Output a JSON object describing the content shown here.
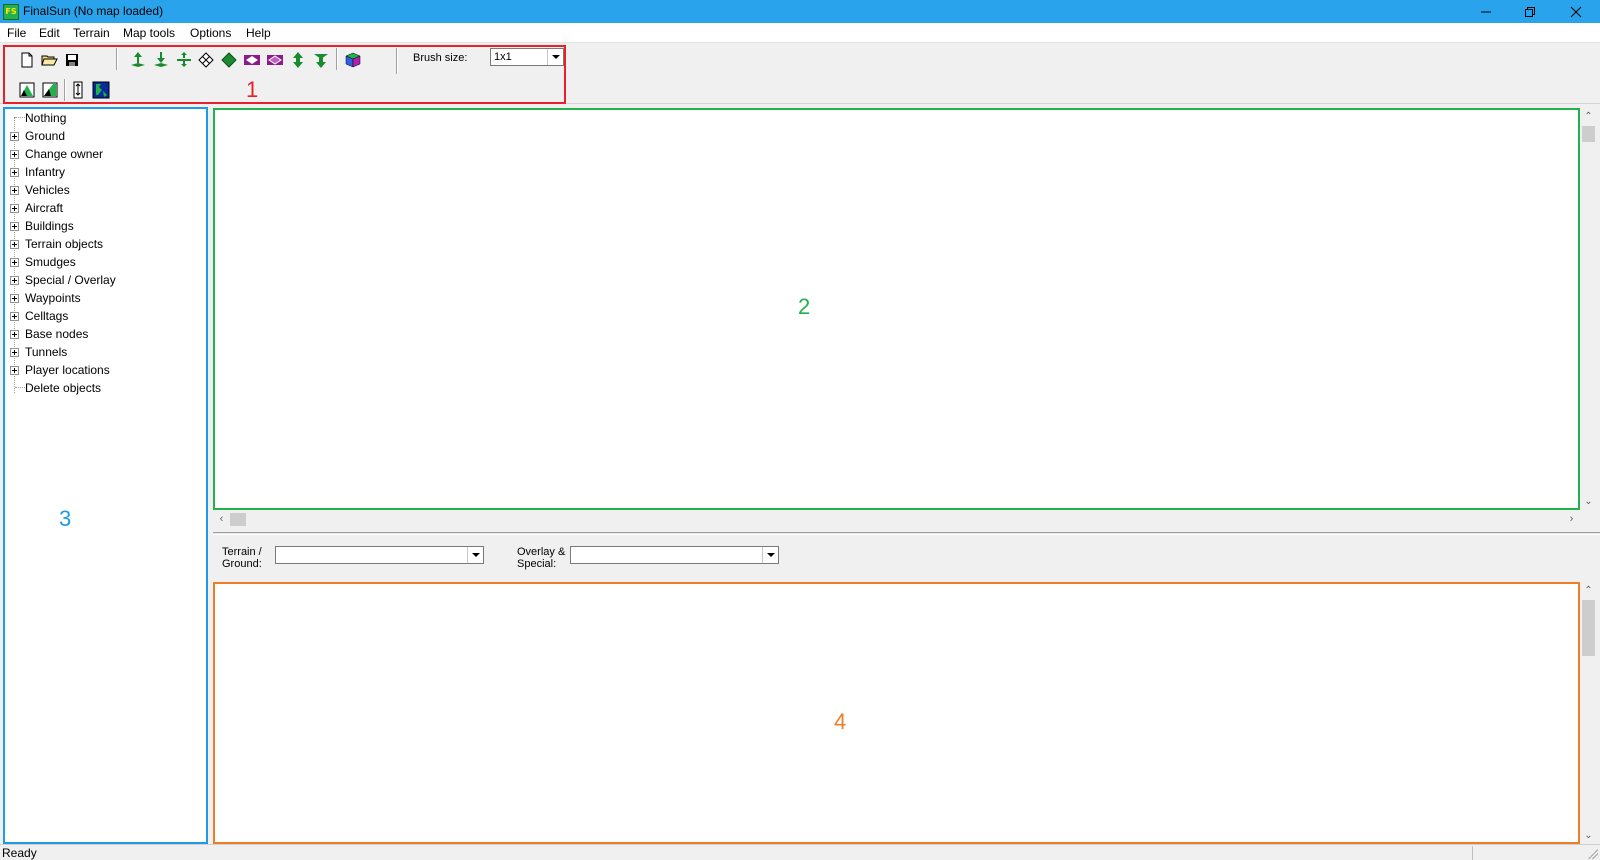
{
  "window": {
    "title": "FinalSun (No map loaded)",
    "icon_text": "FS",
    "controls": [
      "minimize-icon",
      "restore-icon",
      "close-icon"
    ]
  },
  "menu": [
    "File",
    "Edit",
    "Terrain",
    "Map tools",
    "Options",
    "Help"
  ],
  "toolbar": {
    "brush_label": "Brush size:",
    "brush_value": "1x1",
    "row1_icons": [
      "new-file-icon",
      "open-folder-icon",
      "save-icon",
      "raise-ground-icon",
      "lower-ground-icon",
      "flatten-ground-icon",
      "hide-tile-icon",
      "show-tile-icon",
      "raise-tile-purple-icon",
      "lower-tile-purple-icon",
      "raise-single-icon",
      "lower-single-icon",
      "cube-icon"
    ],
    "row2_icons": [
      "terrain-a-icon",
      "terrain-b-icon",
      "tube-icon",
      "waypoint-map-icon"
    ]
  },
  "annotations": {
    "one": "1",
    "two": "2",
    "three": "3",
    "four": "4",
    "colors": {
      "one": "#e8202a",
      "two": "#22b14c",
      "three": "#1e9be6",
      "four": "#ee7d27"
    }
  },
  "tree": {
    "items": [
      {
        "label": "Nothing",
        "expandable": false
      },
      {
        "label": "Ground",
        "expandable": true
      },
      {
        "label": "Change owner",
        "expandable": true
      },
      {
        "label": "Infantry",
        "expandable": true
      },
      {
        "label": "Vehicles",
        "expandable": true
      },
      {
        "label": "Aircraft",
        "expandable": true
      },
      {
        "label": "Buildings",
        "expandable": true
      },
      {
        "label": "Terrain objects",
        "expandable": true
      },
      {
        "label": "Smudges",
        "expandable": true
      },
      {
        "label": "Special / Overlay",
        "expandable": true
      },
      {
        "label": "Waypoints",
        "expandable": true
      },
      {
        "label": "Celltags",
        "expandable": true
      },
      {
        "label": "Base nodes",
        "expandable": true
      },
      {
        "label": "Tunnels",
        "expandable": true
      },
      {
        "label": "Player locations",
        "expandable": true
      },
      {
        "label": "Delete objects",
        "expandable": false
      }
    ]
  },
  "tileset_bar": {
    "terrain_label_1": "Terrain /",
    "terrain_label_2": "Ground:",
    "terrain_value": "",
    "overlay_label_1": "Overlay &",
    "overlay_label_2": "Special:",
    "overlay_value": ""
  },
  "status": {
    "text": "Ready"
  }
}
